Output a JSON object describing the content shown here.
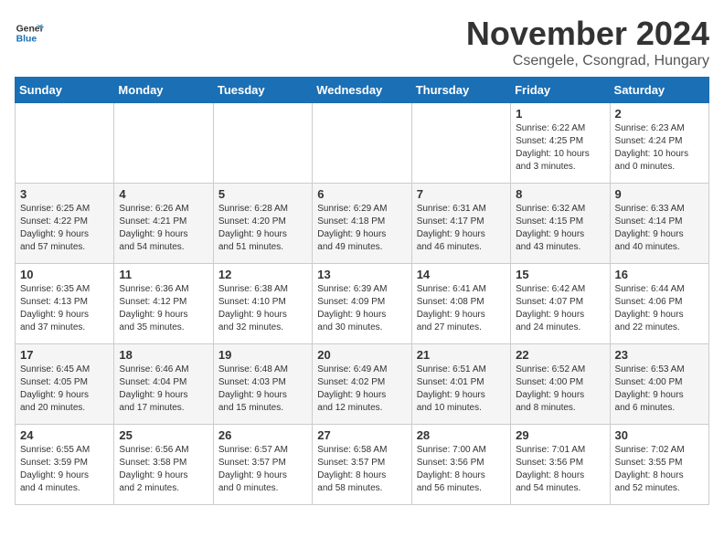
{
  "logo": {
    "line1": "General",
    "line2": "Blue"
  },
  "title": "November 2024",
  "location": "Csengele, Csongrad, Hungary",
  "days_of_week": [
    "Sunday",
    "Monday",
    "Tuesday",
    "Wednesday",
    "Thursday",
    "Friday",
    "Saturday"
  ],
  "weeks": [
    [
      {
        "day": "",
        "info": ""
      },
      {
        "day": "",
        "info": ""
      },
      {
        "day": "",
        "info": ""
      },
      {
        "day": "",
        "info": ""
      },
      {
        "day": "",
        "info": ""
      },
      {
        "day": "1",
        "info": "Sunrise: 6:22 AM\nSunset: 4:25 PM\nDaylight: 10 hours\nand 3 minutes."
      },
      {
        "day": "2",
        "info": "Sunrise: 6:23 AM\nSunset: 4:24 PM\nDaylight: 10 hours\nand 0 minutes."
      }
    ],
    [
      {
        "day": "3",
        "info": "Sunrise: 6:25 AM\nSunset: 4:22 PM\nDaylight: 9 hours\nand 57 minutes."
      },
      {
        "day": "4",
        "info": "Sunrise: 6:26 AM\nSunset: 4:21 PM\nDaylight: 9 hours\nand 54 minutes."
      },
      {
        "day": "5",
        "info": "Sunrise: 6:28 AM\nSunset: 4:20 PM\nDaylight: 9 hours\nand 51 minutes."
      },
      {
        "day": "6",
        "info": "Sunrise: 6:29 AM\nSunset: 4:18 PM\nDaylight: 9 hours\nand 49 minutes."
      },
      {
        "day": "7",
        "info": "Sunrise: 6:31 AM\nSunset: 4:17 PM\nDaylight: 9 hours\nand 46 minutes."
      },
      {
        "day": "8",
        "info": "Sunrise: 6:32 AM\nSunset: 4:15 PM\nDaylight: 9 hours\nand 43 minutes."
      },
      {
        "day": "9",
        "info": "Sunrise: 6:33 AM\nSunset: 4:14 PM\nDaylight: 9 hours\nand 40 minutes."
      }
    ],
    [
      {
        "day": "10",
        "info": "Sunrise: 6:35 AM\nSunset: 4:13 PM\nDaylight: 9 hours\nand 37 minutes."
      },
      {
        "day": "11",
        "info": "Sunrise: 6:36 AM\nSunset: 4:12 PM\nDaylight: 9 hours\nand 35 minutes."
      },
      {
        "day": "12",
        "info": "Sunrise: 6:38 AM\nSunset: 4:10 PM\nDaylight: 9 hours\nand 32 minutes."
      },
      {
        "day": "13",
        "info": "Sunrise: 6:39 AM\nSunset: 4:09 PM\nDaylight: 9 hours\nand 30 minutes."
      },
      {
        "day": "14",
        "info": "Sunrise: 6:41 AM\nSunset: 4:08 PM\nDaylight: 9 hours\nand 27 minutes."
      },
      {
        "day": "15",
        "info": "Sunrise: 6:42 AM\nSunset: 4:07 PM\nDaylight: 9 hours\nand 24 minutes."
      },
      {
        "day": "16",
        "info": "Sunrise: 6:44 AM\nSunset: 4:06 PM\nDaylight: 9 hours\nand 22 minutes."
      }
    ],
    [
      {
        "day": "17",
        "info": "Sunrise: 6:45 AM\nSunset: 4:05 PM\nDaylight: 9 hours\nand 20 minutes."
      },
      {
        "day": "18",
        "info": "Sunrise: 6:46 AM\nSunset: 4:04 PM\nDaylight: 9 hours\nand 17 minutes."
      },
      {
        "day": "19",
        "info": "Sunrise: 6:48 AM\nSunset: 4:03 PM\nDaylight: 9 hours\nand 15 minutes."
      },
      {
        "day": "20",
        "info": "Sunrise: 6:49 AM\nSunset: 4:02 PM\nDaylight: 9 hours\nand 12 minutes."
      },
      {
        "day": "21",
        "info": "Sunrise: 6:51 AM\nSunset: 4:01 PM\nDaylight: 9 hours\nand 10 minutes."
      },
      {
        "day": "22",
        "info": "Sunrise: 6:52 AM\nSunset: 4:00 PM\nDaylight: 9 hours\nand 8 minutes."
      },
      {
        "day": "23",
        "info": "Sunrise: 6:53 AM\nSunset: 4:00 PM\nDaylight: 9 hours\nand 6 minutes."
      }
    ],
    [
      {
        "day": "24",
        "info": "Sunrise: 6:55 AM\nSunset: 3:59 PM\nDaylight: 9 hours\nand 4 minutes."
      },
      {
        "day": "25",
        "info": "Sunrise: 6:56 AM\nSunset: 3:58 PM\nDaylight: 9 hours\nand 2 minutes."
      },
      {
        "day": "26",
        "info": "Sunrise: 6:57 AM\nSunset: 3:57 PM\nDaylight: 9 hours\nand 0 minutes."
      },
      {
        "day": "27",
        "info": "Sunrise: 6:58 AM\nSunset: 3:57 PM\nDaylight: 8 hours\nand 58 minutes."
      },
      {
        "day": "28",
        "info": "Sunrise: 7:00 AM\nSunset: 3:56 PM\nDaylight: 8 hours\nand 56 minutes."
      },
      {
        "day": "29",
        "info": "Sunrise: 7:01 AM\nSunset: 3:56 PM\nDaylight: 8 hours\nand 54 minutes."
      },
      {
        "day": "30",
        "info": "Sunrise: 7:02 AM\nSunset: 3:55 PM\nDaylight: 8 hours\nand 52 minutes."
      }
    ]
  ]
}
